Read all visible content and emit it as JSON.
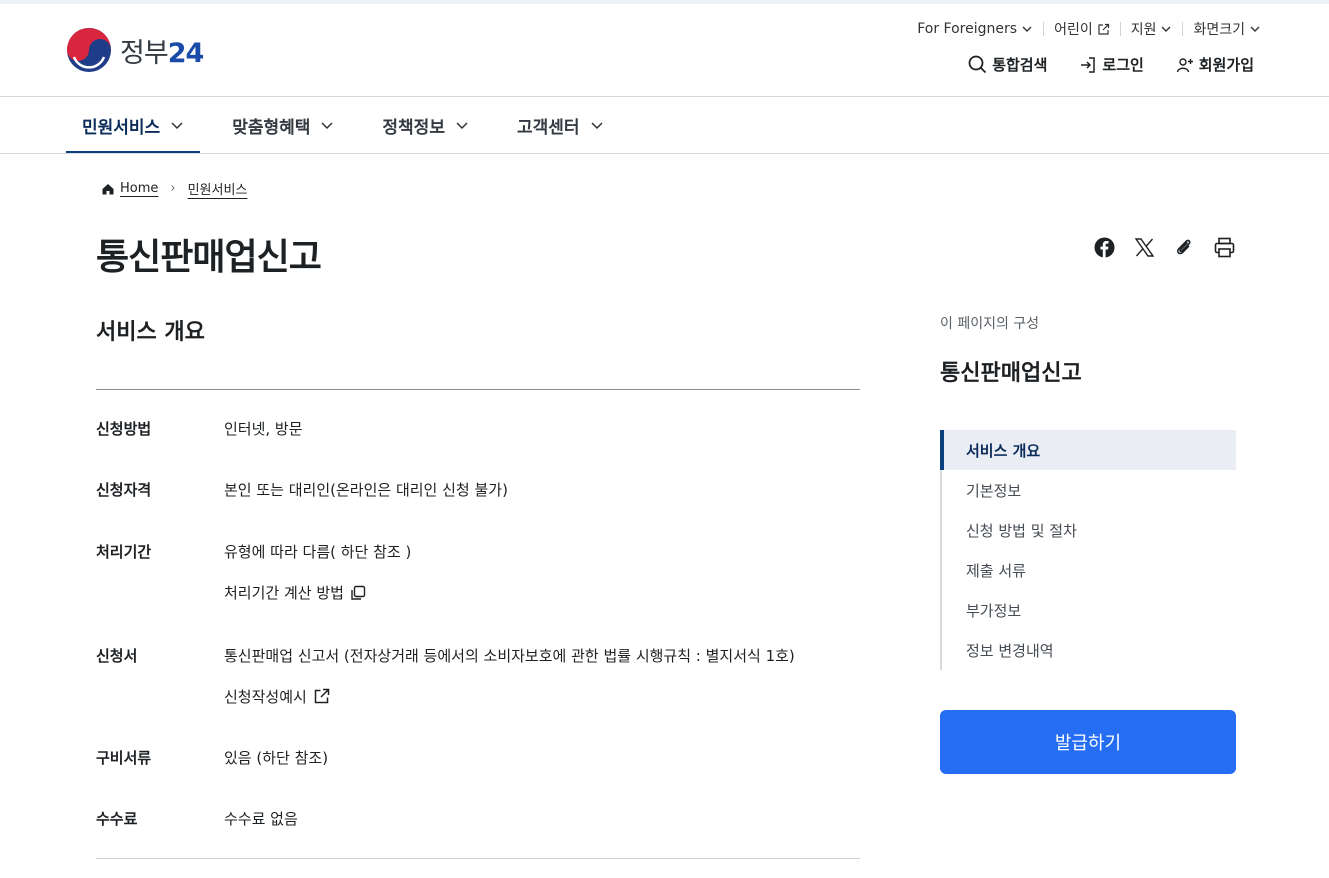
{
  "header": {
    "logo_text": "정부",
    "logo_num": "24",
    "util": {
      "foreigners": "For Foreigners",
      "kids": "어린이",
      "support": "지원",
      "fontsize": "화면크기"
    },
    "auth": {
      "search": "통합검색",
      "login": "로그인",
      "signup": "회원가입"
    }
  },
  "gnb": {
    "items": [
      "민원서비스",
      "맞춤형혜택",
      "정책정보",
      "고객센터"
    ],
    "active_index": 0
  },
  "breadcrumb": {
    "home": "Home",
    "current": "민원서비스"
  },
  "page": {
    "title": "통신판매업신고",
    "section_title": "서비스 개요"
  },
  "overview": {
    "method_label": "신청방법",
    "method_value": "인터넷, 방문",
    "eligibility_label": "신청자격",
    "eligibility_value": "본인 또는 대리인(온라인은 대리인 신청 불가)",
    "period_label": "처리기간",
    "period_value": "유형에 따라 다름( 하단 참조 )",
    "period_link": "처리기간 계산 방법",
    "form_label": "신청서",
    "form_value": "통신판매업 신고서 (전자상거래 등에서의 소비자보호에 관한 법률 시행규칙 : 별지서식 1호)",
    "form_link": "신청작성예시",
    "docs_label": "구비서류",
    "docs_value": "있음 (하단 참조)",
    "fee_label": "수수료",
    "fee_value": "수수료 없음"
  },
  "toc": {
    "caption": "이 페이지의 구성",
    "title": "통신판매업신고",
    "items": [
      "서비스 개요",
      "기본정보",
      "신청 방법 및 절차",
      "제출 서류",
      "부가정보",
      "정보 변경내역"
    ],
    "active_index": 0
  },
  "issue_button": "발급하기",
  "icons": {
    "share": [
      "facebook-icon",
      "x-icon",
      "link-icon",
      "print-icon"
    ]
  },
  "colors": {
    "primary": "#256ef4",
    "navy": "#0b3f7e",
    "text": "#1e2124"
  }
}
